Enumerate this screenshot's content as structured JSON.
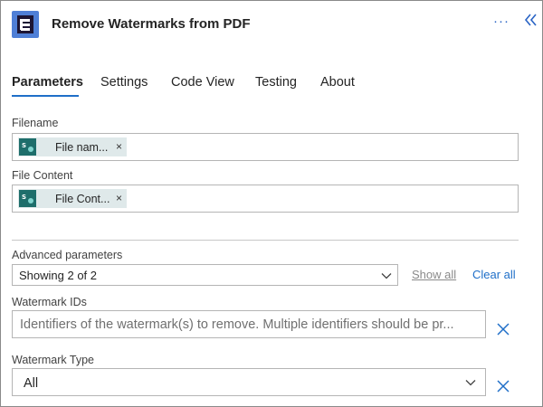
{
  "header": {
    "title": "Remove Watermarks from PDF",
    "more_label": "···",
    "app_icon": "pdf-app-icon",
    "collapse_icon": "double-chevron-left-icon"
  },
  "tabs": [
    {
      "label": "Parameters",
      "active": true
    },
    {
      "label": "Settings",
      "active": false
    },
    {
      "label": "Code View",
      "active": false
    },
    {
      "label": "Testing",
      "active": false
    },
    {
      "label": "About",
      "active": false
    }
  ],
  "fields": {
    "filename": {
      "label": "Filename",
      "token": "File nam...",
      "remove": "×"
    },
    "file_content": {
      "label": "File Content",
      "token": "File Cont...",
      "remove": "×"
    }
  },
  "advanced": {
    "label": "Advanced parameters",
    "selected": "Showing 2 of 2",
    "show_all": "Show all",
    "clear_all": "Clear all"
  },
  "watermark_ids": {
    "label": "Watermark IDs",
    "placeholder": "Identifiers of the watermark(s) to remove. Multiple identifiers should be pr..."
  },
  "watermark_type": {
    "label": "Watermark Type",
    "selected": "All"
  },
  "colors": {
    "accent": "#1f6fc8",
    "app_icon_bg": "#4f7fd6",
    "token_bg": "#dfe9ea",
    "token_logo": "#1e6e6b"
  }
}
